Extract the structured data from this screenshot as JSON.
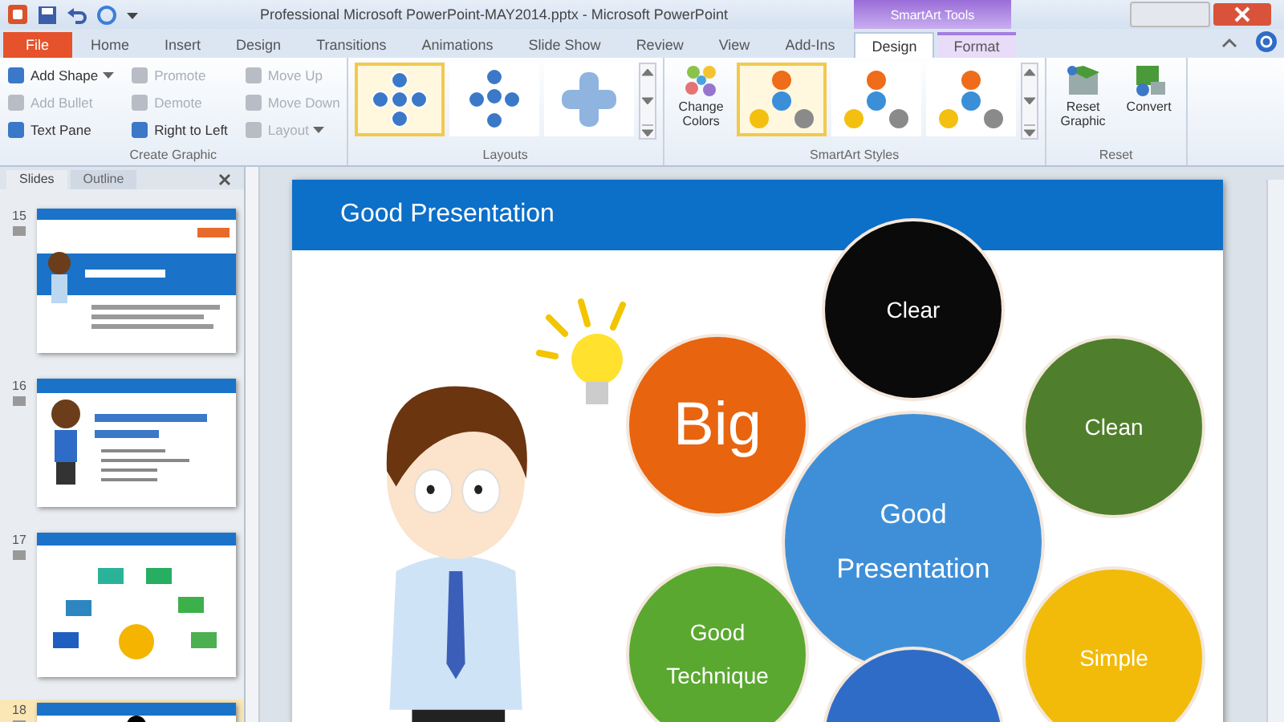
{
  "window": {
    "title": "Professional Microsoft PowerPoint-MAY2014.pptx  -  Microsoft PowerPoint",
    "context_label": "SmartArt Tools"
  },
  "tabs": [
    {
      "label": "File",
      "kind": "file",
      "selected": false
    },
    {
      "label": "Home",
      "kind": "tab",
      "selected": false
    },
    {
      "label": "Insert",
      "kind": "tab",
      "selected": false
    },
    {
      "label": "Design",
      "kind": "tab",
      "selected": false
    },
    {
      "label": "Transitions",
      "kind": "tab",
      "selected": false
    },
    {
      "label": "Animations",
      "kind": "tab",
      "selected": false
    },
    {
      "label": "Slide Show",
      "kind": "tab",
      "selected": false
    },
    {
      "label": "Review",
      "kind": "tab",
      "selected": false
    },
    {
      "label": "View",
      "kind": "tab",
      "selected": false
    },
    {
      "label": "Add-Ins",
      "kind": "tab",
      "selected": false
    },
    {
      "label": "Design",
      "kind": "context",
      "selected": true
    },
    {
      "label": "Format",
      "kind": "context",
      "selected": false
    }
  ],
  "ribbon": {
    "create_graphic": {
      "label": "Create Graphic",
      "columns": [
        [
          {
            "label": "Add Shape",
            "disabled": false,
            "dropdown": true
          },
          {
            "label": "Add Bullet",
            "disabled": true,
            "dropdown": false
          },
          {
            "label": "Text Pane",
            "disabled": false,
            "dropdown": false
          }
        ],
        [
          {
            "label": "Promote",
            "disabled": true,
            "dropdown": false
          },
          {
            "label": "Demote",
            "disabled": true,
            "dropdown": false
          },
          {
            "label": "Right to Left",
            "disabled": false,
            "dropdown": false
          }
        ],
        [
          {
            "label": "Move Up",
            "disabled": true,
            "dropdown": false
          },
          {
            "label": "Move Down",
            "disabled": true,
            "dropdown": false
          },
          {
            "label": "Layout",
            "disabled": true,
            "dropdown": true
          }
        ]
      ]
    },
    "layouts": {
      "label": "Layouts",
      "items": [
        {
          "selected": true
        },
        {
          "selected": false
        },
        {
          "selected": false
        }
      ]
    },
    "styles": {
      "label": "SmartArt Styles",
      "change_colors": "Change Colors",
      "items": [
        {
          "selected": true
        },
        {
          "selected": false
        },
        {
          "selected": false
        }
      ]
    },
    "reset": {
      "label": "Reset",
      "buttons": [
        "Reset Graphic",
        "Convert"
      ]
    }
  },
  "pane": {
    "tabs": [
      {
        "label": "Slides",
        "selected": true
      },
      {
        "label": "Outline",
        "selected": false
      }
    ],
    "slides": [
      {
        "number": "15",
        "selected": false,
        "kind": "intro"
      },
      {
        "number": "16",
        "selected": false,
        "kind": "list"
      },
      {
        "number": "17",
        "selected": false,
        "kind": "diagram"
      },
      {
        "number": "18",
        "selected": true,
        "kind": "current"
      }
    ]
  },
  "slide": {
    "title": "Good Presentation",
    "bubbles": [
      {
        "text": "Clear",
        "color": "#0a0a0a",
        "kind": "small"
      },
      {
        "text": "Big",
        "color": "#e8640e",
        "kind": "big"
      },
      {
        "text": "Clean",
        "color": "#4f7f2c",
        "kind": "small"
      },
      {
        "text": "Good Presentation",
        "color": "#3f8fd8",
        "kind": "center"
      },
      {
        "text": "Good Technique",
        "color": "#5aa830",
        "kind": "small"
      },
      {
        "text": "Simple",
        "color": "#f2bb0a",
        "kind": "small"
      },
      {
        "color": "#2f6cc8",
        "kind": "small"
      }
    ]
  }
}
